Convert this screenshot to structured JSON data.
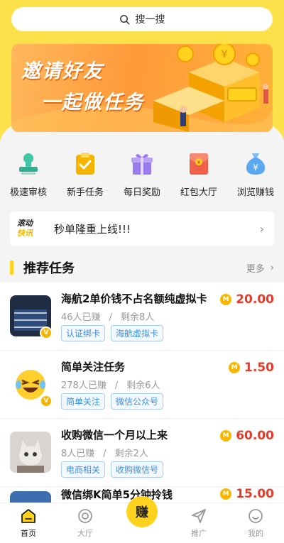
{
  "search": {
    "label": "搜一搜"
  },
  "banner": {
    "line1": "邀请好友",
    "line2": "一起做任务"
  },
  "quick_actions": [
    {
      "label": "极速审核",
      "icon": "stamp-icon",
      "color": "#3ec7a3"
    },
    {
      "label": "新手任务",
      "icon": "clipboard-check-icon",
      "color": "#f5b400"
    },
    {
      "label": "每日奖励",
      "icon": "gift-icon",
      "color": "#9a7cf0"
    },
    {
      "label": "红包大厅",
      "icon": "red-envelope-icon",
      "color": "#f0604a"
    },
    {
      "label": "浏览赚钱",
      "icon": "money-bag-icon",
      "color": "#5aa8f0"
    }
  ],
  "notice": {
    "badge_line1": "滚动",
    "badge_line2": "快讯",
    "text": "秒单隆重上线!!!"
  },
  "section": {
    "title": "推荐任务",
    "more": "更多"
  },
  "tasks": [
    {
      "title": "海航2单价钱不占名额纯虚拟卡",
      "earned": "46人已赚",
      "remaining": "剩余8人",
      "tags": [
        "认证绑卡",
        "海航虚拟卡"
      ],
      "price": "20.00",
      "thumb": "book-cover-image"
    },
    {
      "title": "简单关注任务",
      "earned": "278人已赚",
      "remaining": "剩余6人",
      "tags": [
        "简单关注",
        "微信公众号"
      ],
      "price": "1.50",
      "thumb": "laughing-emoji-image"
    },
    {
      "title": "收购微信一个月以上来",
      "earned": "8人已赚",
      "remaining": "剩余2人",
      "tags": [
        "电商相关",
        "收购微信号"
      ],
      "price": "60.00",
      "thumb": "cat-image"
    },
    {
      "title": "微信绑K简单5分钟拎钱",
      "earned": "",
      "remaining": "",
      "tags": [],
      "price": "15.00",
      "thumb": "card-image"
    }
  ],
  "coin_label": "M",
  "badge_v": "V",
  "separator": "/",
  "chevron": "›",
  "tabbar": [
    {
      "label": "首页",
      "icon": "home-icon",
      "active": true
    },
    {
      "label": "大厅",
      "icon": "hall-icon",
      "active": false
    },
    {
      "label": "赚",
      "icon": "earn-icon",
      "active": false
    },
    {
      "label": "推广",
      "icon": "paper-plane-icon",
      "active": false
    },
    {
      "label": "我的",
      "icon": "profile-icon",
      "active": false
    }
  ]
}
